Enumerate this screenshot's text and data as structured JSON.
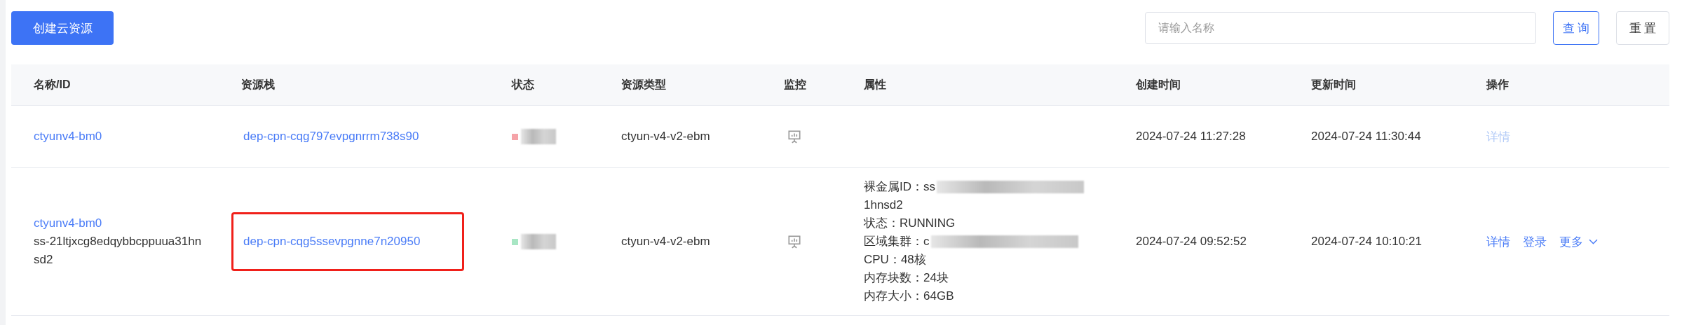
{
  "toolbar": {
    "create_button": "创建云资源",
    "search": {
      "placeholder": "请输入名称"
    },
    "query_button": "查 询",
    "reset_button": "重 置"
  },
  "table": {
    "columns": [
      "名称/ID",
      "资源栈",
      "状态",
      "资源类型",
      "监控",
      "属性",
      "创建时间",
      "更新时间",
      "操作"
    ],
    "rows": [
      {
        "name": "ctyunv4-bm0",
        "id": "",
        "stack": "dep-cpn-cqg797evpgnrrm738s90",
        "stack_highlighted": false,
        "status": {
          "color": "#f5a3a8"
        },
        "type": "ctyun-v4-v2-ebm",
        "properties": [],
        "created": "2024-07-24 11:27:28",
        "updated": "2024-07-24 11:30:44",
        "actions": [
          {
            "label": "详情",
            "disabled": true
          }
        ],
        "more": ""
      },
      {
        "name": "ctyunv4-bm0",
        "id": "ss-21ltjxcg8edqybbcppuua31hnsd2",
        "stack": "dep-cpn-cqg5ssevpgnne7n20950",
        "stack_highlighted": true,
        "status": {
          "color": "#a8e6c4"
        },
        "type": "ctyun-v4-v2-ebm",
        "properties": [
          {
            "kind": "redacted",
            "text": "裸金属ID：ss"
          },
          {
            "kind": "text",
            "text": "1hnsd2"
          },
          {
            "kind": "text",
            "text": "状态：RUNNING"
          },
          {
            "kind": "redacted",
            "text": "区域集群：c"
          },
          {
            "kind": "text",
            "text": "CPU：48核"
          },
          {
            "kind": "text",
            "text": "内存块数：24块"
          },
          {
            "kind": "text",
            "text": "内存大小：64GB"
          }
        ],
        "created": "2024-07-24 09:52:52",
        "updated": "2024-07-24 10:10:21",
        "actions": [
          {
            "label": "详情",
            "disabled": false
          },
          {
            "label": "登录",
            "disabled": false
          }
        ],
        "more": "更多"
      }
    ]
  }
}
